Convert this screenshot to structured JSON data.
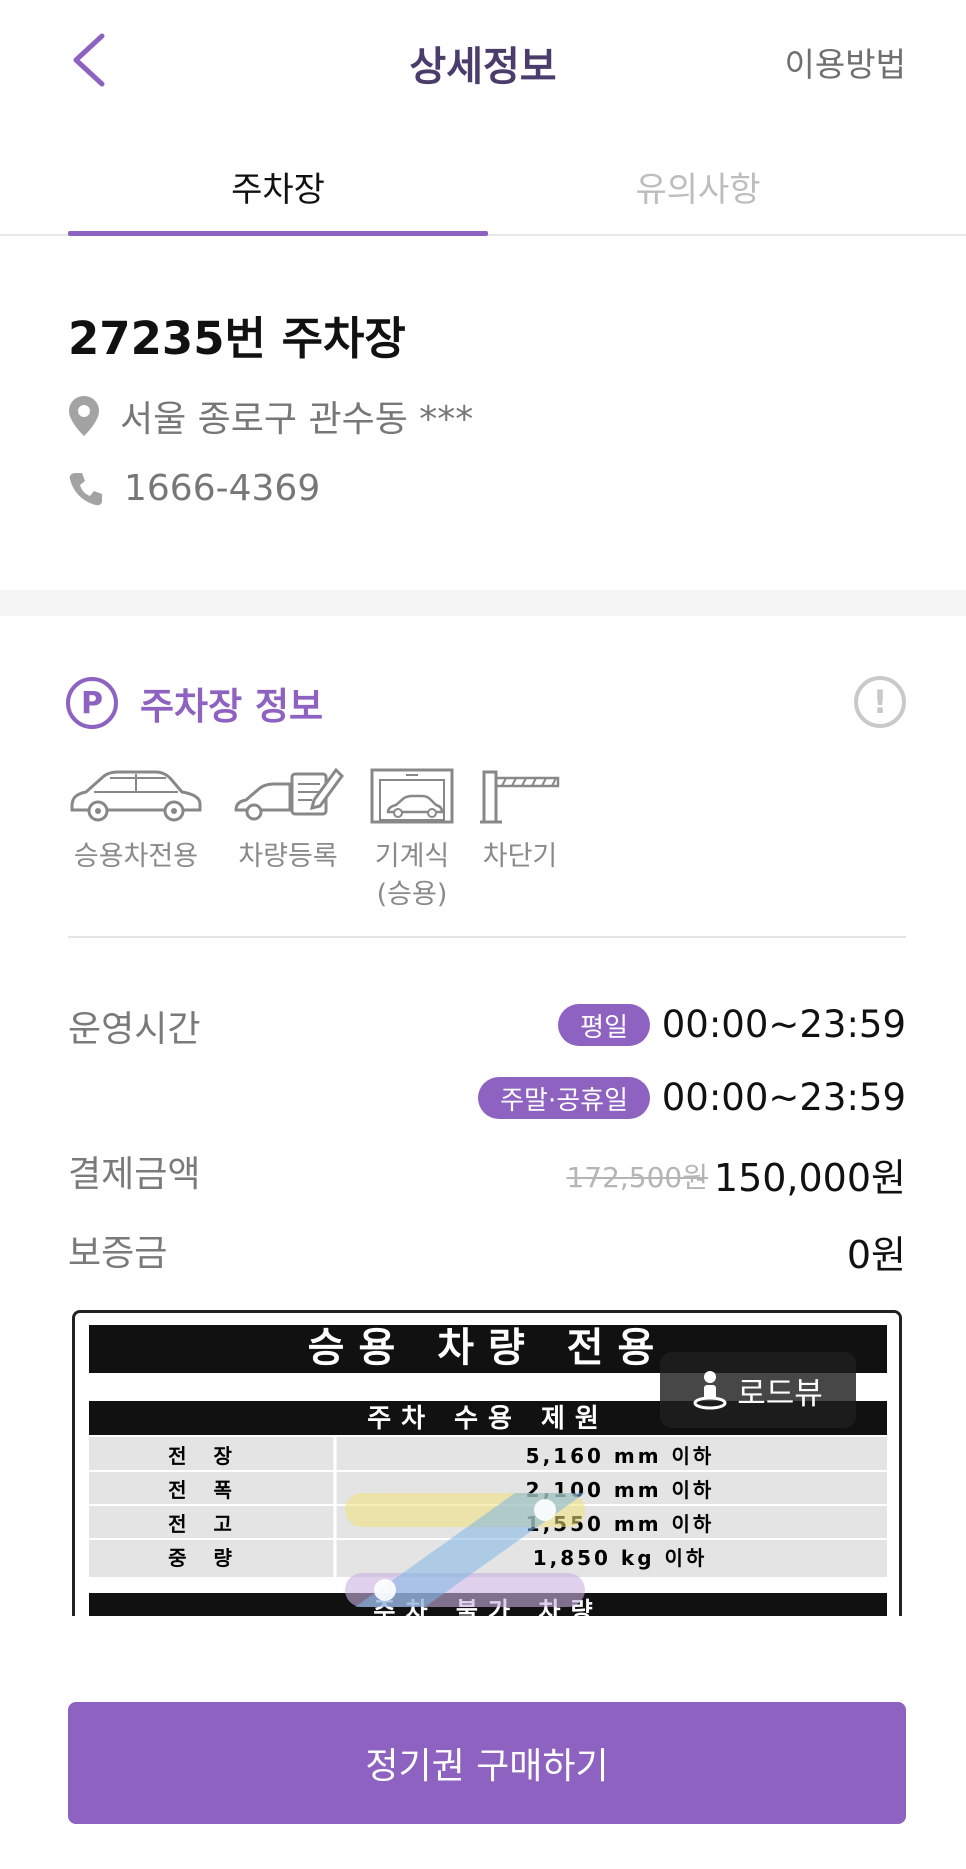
{
  "header": {
    "title": "상세정보",
    "help_label": "이용방법",
    "back_icon": "chevron-left-icon"
  },
  "tabs": [
    {
      "label": "주차장",
      "active": true
    },
    {
      "label": "유의사항",
      "active": false
    }
  ],
  "lot": {
    "name": "27235번 주차장",
    "address": "서울 종로구 관수동 ***",
    "phone": "1666-4369"
  },
  "section": {
    "title": "주차장 정보",
    "p_icon_label": "P",
    "info_icon_label": "!"
  },
  "features": [
    {
      "icon": "sedan-icon",
      "label": "승용차전용"
    },
    {
      "icon": "car-registration-icon",
      "label": "차량등록"
    },
    {
      "icon": "mechanical-parking-icon",
      "label": "기계식\n(승용)"
    },
    {
      "icon": "barrier-gate-icon",
      "label": "차단기"
    }
  ],
  "details": {
    "hours_label": "운영시간",
    "weekday_badge": "평일",
    "weekday_hours": "00:00~23:59",
    "weekend_badge": "주말·공휴일",
    "weekend_hours": "00:00~23:59",
    "payment_label": "결제금액",
    "original_price": "172,500원",
    "price": "150,000원",
    "deposit_label": "보증금",
    "deposit": "0원"
  },
  "sign": {
    "title": "승용 차량 전용",
    "spec_header": "주차 수용 제원",
    "rows": [
      {
        "k": "전 장",
        "v": "5,160 mm 이하"
      },
      {
        "k": "전 폭",
        "v": "2,100 mm 이하"
      },
      {
        "k": "전 고",
        "v": "1,550 mm 이하"
      },
      {
        "k": "중 량",
        "v": "1,850 kg 이하"
      }
    ],
    "footer": "주차 불가 차량"
  },
  "roadview_label": "로드뷰",
  "cta_label": "정기권 구매하기",
  "colors": {
    "accent": "#8e62c0",
    "title": "#4a3d6b"
  }
}
